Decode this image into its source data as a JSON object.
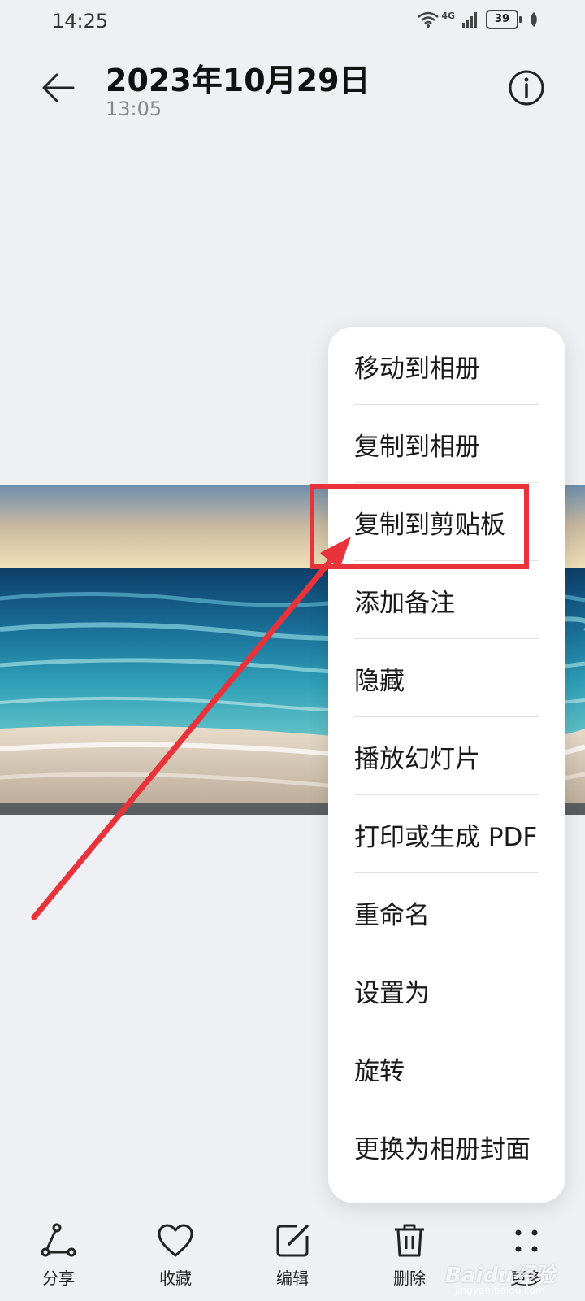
{
  "status_bar": {
    "time": "14:25",
    "network": "4G",
    "battery": "39"
  },
  "header": {
    "title": "2023年10月29日",
    "subtitle": "13:05"
  },
  "menu": {
    "items": [
      {
        "label": "移动到相册"
      },
      {
        "label": "复制到相册"
      },
      {
        "label": "复制到剪贴板"
      },
      {
        "label": "添加备注"
      },
      {
        "label": "隐藏"
      },
      {
        "label": "播放幻灯片"
      },
      {
        "label": "打印或生成 PDF"
      },
      {
        "label": "重命名"
      },
      {
        "label": "设置为"
      },
      {
        "label": "旋转"
      },
      {
        "label": "更换为相册封面"
      }
    ]
  },
  "toolbar": {
    "share": "分享",
    "favorite": "收藏",
    "edit": "编辑",
    "delete": "删除",
    "more": "更多"
  },
  "watermark": {
    "brand": "Baidu经验",
    "url": "jingyan.baidu.com"
  },
  "colors": {
    "highlight": "#e8333b",
    "background": "#eef0f4",
    "menu_bg": "#ffffff"
  },
  "icons": [
    "back-arrow-icon",
    "info-icon",
    "wifi-icon",
    "signal-icon",
    "battery-icon",
    "share-icon",
    "heart-icon",
    "edit-icon",
    "trash-icon",
    "more-dots-icon"
  ]
}
